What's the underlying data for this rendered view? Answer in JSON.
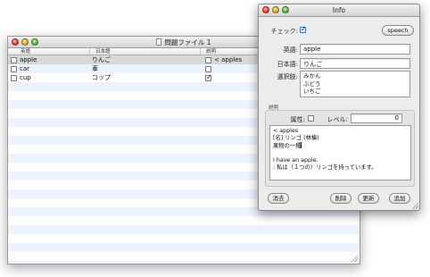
{
  "main_window": {
    "title": "問題ファイル 1",
    "columns": [
      "英語",
      "日本語",
      "説明"
    ],
    "rows": [
      {
        "checked": false,
        "english": "apple",
        "japanese": "りんご",
        "note_checked": false,
        "note": "< apples",
        "selected": true
      },
      {
        "checked": false,
        "english": "car",
        "japanese": "車",
        "note_checked": false,
        "note": "",
        "selected": false
      },
      {
        "checked": false,
        "english": "cup",
        "japanese": "コップ",
        "note_checked": true,
        "note": "",
        "selected": false
      }
    ]
  },
  "info_panel": {
    "title": "Info",
    "check_label": "チェック:",
    "check_value": true,
    "speech_label": "speech",
    "english_label": "英語:",
    "english_value": "apple",
    "japanese_label": "日本語:",
    "japanese_value": "りんご",
    "choices_label": "選択肢:",
    "choices": [
      "みかん",
      "ぶどう",
      "いちご"
    ],
    "description_group_title": "説明",
    "attribute_label": "属性:",
    "level_label": "レベル:",
    "level_value": "0",
    "description_text": "< apples\n[名] リンゴ (林檎)\n果物の一種\n\nI have an apple.\n: 私は（１つの）リンゴを持っています。",
    "buttons": {
      "delete": "消去",
      "remove": "削除",
      "update": "更新",
      "add": "追加"
    }
  },
  "colors": {
    "row_stripe": "#edf3fe",
    "selected_row": "#d8d8d8",
    "panel_bg": "#ececec"
  }
}
